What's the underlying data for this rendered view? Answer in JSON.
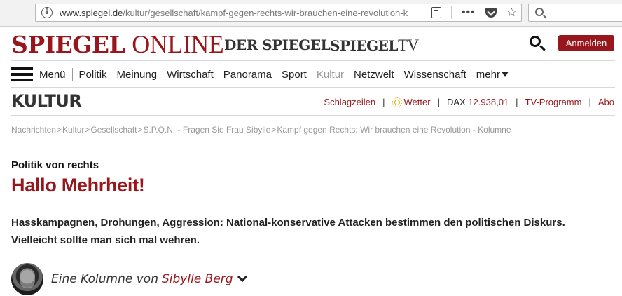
{
  "browser": {
    "url_domain": "www.spiegel.de",
    "url_path": "/kultur/gesellschaft/kampf-gegen-rechts-wir-brauchen-eine-revolution-k",
    "menu_dots": "•••",
    "bookmark_star": "☆"
  },
  "brand": {
    "logo_bold": "SPIEGEL",
    "logo_thin": "ONLINE",
    "der_spiegel": "DER SPIEGEL",
    "tv_bold": "SPIEGEL",
    "tv_thin": "TV",
    "login_label": "Anmelden"
  },
  "nav": {
    "menu_label": "Menü",
    "items": [
      "Politik",
      "Meinung",
      "Wirtschaft",
      "Panorama",
      "Sport",
      "Kultur",
      "Netzwelt",
      "Wissenschaft"
    ],
    "active": "Kultur",
    "more_label": "mehr"
  },
  "section": {
    "title": "KULTUR",
    "headlines_label": "Schlagzeilen",
    "weather_label": "Wetter",
    "dax_label": "DAX",
    "dax_value": "12.938,01",
    "tv_label": "TV-Programm",
    "abo_label": "Abo"
  },
  "breadcrumb": {
    "items": [
      "Nachrichten",
      "Kultur",
      "Gesellschaft",
      "S.P.O.N. - Fragen Sie Frau Sibylle",
      "Kampf gegen Rechts: Wir brauchen eine Revolution - Kolumne"
    ],
    "separator": ">"
  },
  "article": {
    "kicker": "Politik von rechts",
    "headline": "Hallo Mehrheit!",
    "teaser": "Hasskampagnen, Drohungen, Aggression: National-konservative Attacken bestimmen den politischen Diskurs. Vielleicht sollte man sich mal wehren.",
    "byline_prefix": "Eine Kolumne von",
    "author": "Sibylle Berg"
  },
  "colors": {
    "brand_red": "#98171d",
    "muted_gray": "#999999"
  }
}
